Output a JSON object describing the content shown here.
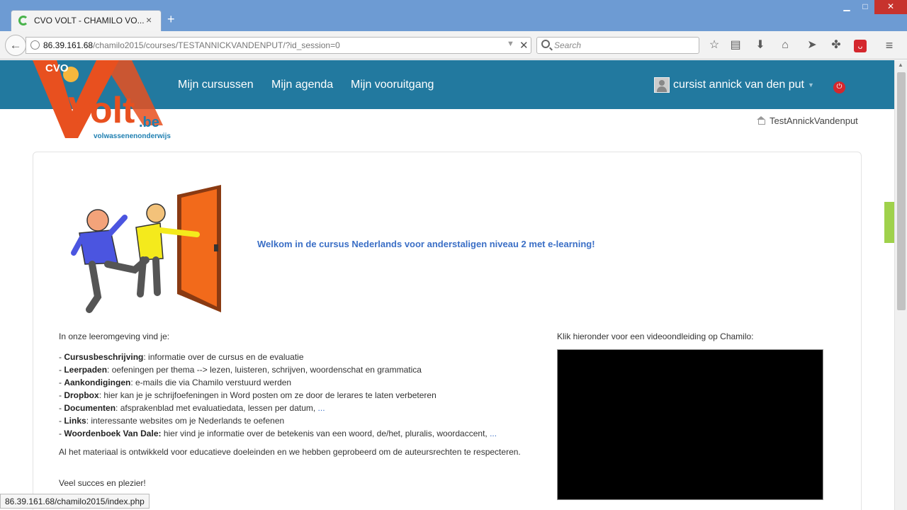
{
  "browser": {
    "tab_title": "CVO VOLT - CHAMILO VO...",
    "tab_close": "×",
    "new_tab": "+",
    "window_controls": {
      "minimize": "▁",
      "maximize": "□",
      "close": "✕"
    },
    "url_host": "86.39.161.68",
    "url_path": "/chamilo2015/courses/TESTANNICKVANDENPUT/?id_session=0",
    "search_placeholder": "Search",
    "icons": [
      "back-arrow-icon",
      "globe-icon",
      "dropdown-icon",
      "close-icon",
      "search-icon",
      "star-icon",
      "reading-list-icon",
      "download-icon",
      "home-icon",
      "send-icon",
      "extension-icon",
      "pdf-icon",
      "menu-icon"
    ],
    "status_url": "86.39.161.68/chamilo2015/index.php"
  },
  "site": {
    "logo_text": "CVO",
    "logo_word": "Volt",
    "logo_domain": ".be",
    "logo_tagline": "volwassenenonderwijs",
    "nav": [
      "Mijn cursussen",
      "Mijn agenda",
      "Mijn vooruitgang"
    ],
    "user_name": "cursist annick van den put",
    "breadcrumb": "TestAnnickVandenput",
    "colors": {
      "header": "#22799f",
      "link": "#3b6fc6",
      "logo_orange": "#e8501f",
      "logo_blue": "#1e7fb1"
    }
  },
  "course": {
    "welcome": "Welkom in de cursus Nederlands voor anderstaligen niveau 2 met e-learning!",
    "intro": "In onze leeromgeving vind je:",
    "features": [
      {
        "name": "Cursusbeschrijving",
        "desc": ": informatie over de cursus en de evaluatie",
        "more": ""
      },
      {
        "name": "Leerpaden",
        "desc": ": oefeningen per thema --> lezen, luisteren, schrijven, woordenschat en grammatica",
        "more": ""
      },
      {
        "name": "Aankondigingen",
        "desc": ": e-mails die via Chamilo verstuurd werden",
        "more": ""
      },
      {
        "name": "Dropbox",
        "desc": ": hier kan je je schrijfoefeningen in Word posten om ze door de lerares te laten verbeteren",
        "more": ""
      },
      {
        "name": "Documenten",
        "desc": ": afsprakenblad met evaluatiedata, lessen per datum, ",
        "more": "..."
      },
      {
        "name": "Links",
        "desc": ": interessante websites om je Nederlands te oefenen",
        "more": ""
      },
      {
        "name": "Woordenboek Van Dale:",
        "desc": " hier vind je informatie over de betekenis van een woord, de/het, pluralis, woordaccent, ",
        "more": "..."
      }
    ],
    "note": "Al het materiaal is ontwikkeld voor educatieve doeleinden en we hebben geprobeerd om de auteursrechten te respecteren.",
    "good_luck": "Veel succes en plezier!",
    "video_label": "Klik hieronder voor een videoondleiding op Chamilo:"
  }
}
